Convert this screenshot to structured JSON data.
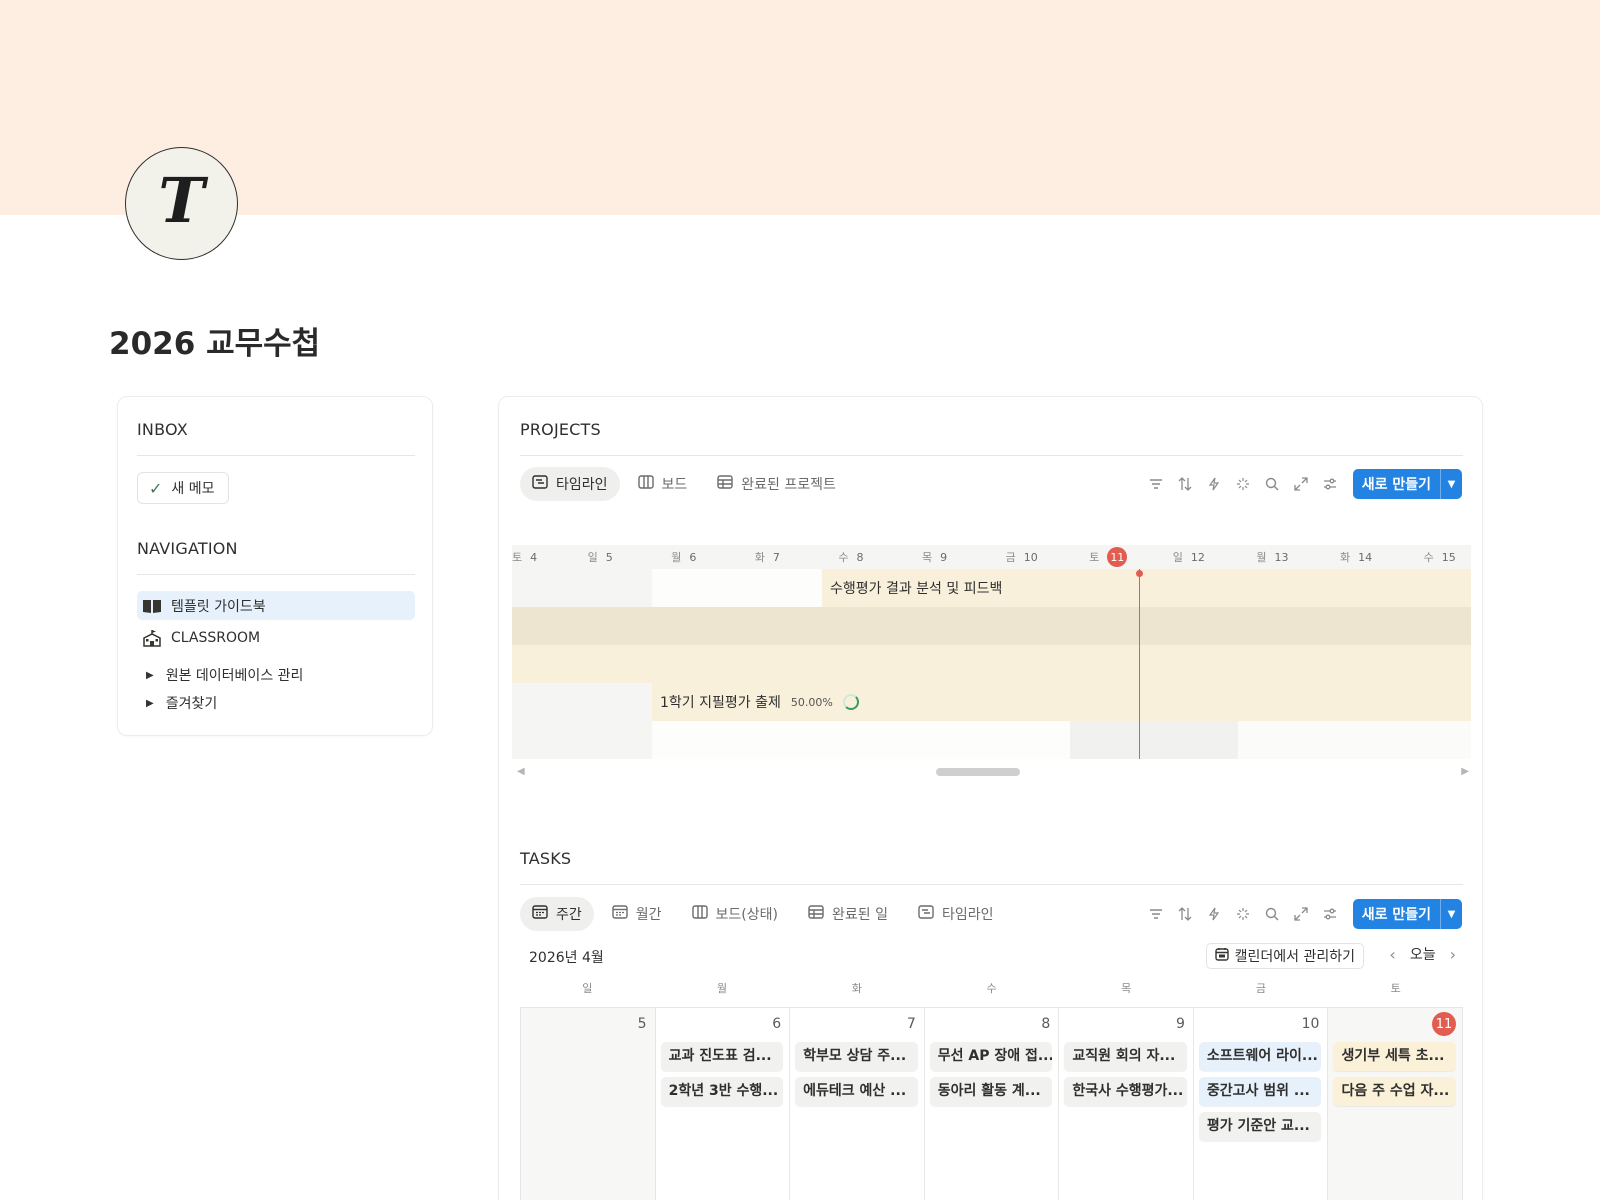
{
  "page": {
    "title": "2026 교무수첩",
    "logo_letter": "T",
    "cover_color": "#fdeee1"
  },
  "inbox": {
    "title": "INBOX",
    "memo_button": "새 메모"
  },
  "navigation": {
    "title": "NAVIGATION",
    "items": [
      {
        "label": "템플릿 가이드북",
        "icon": "book-icon",
        "active": true
      },
      {
        "label": "CLASSROOM",
        "icon": "school-icon",
        "active": false
      }
    ],
    "tree": [
      {
        "label": "원본 데이터베이스 관리"
      },
      {
        "label": "즐겨찾기"
      }
    ]
  },
  "projects": {
    "title": "PROJECTS",
    "tabs": [
      {
        "label": "타임라인",
        "icon": "timeline-icon",
        "active": true
      },
      {
        "label": "보드",
        "icon": "board-icon",
        "active": false
      },
      {
        "label": "완료된 프로젝트",
        "icon": "table-icon",
        "active": false
      }
    ],
    "new_button": "새로 만들기",
    "timeline": {
      "days": [
        {
          "dow": "토",
          "num": "4"
        },
        {
          "dow": "일",
          "num": "5"
        },
        {
          "dow": "월",
          "num": "6"
        },
        {
          "dow": "화",
          "num": "7"
        },
        {
          "dow": "수",
          "num": "8"
        },
        {
          "dow": "목",
          "num": "9"
        },
        {
          "dow": "금",
          "num": "10"
        },
        {
          "dow": "토",
          "num": "11",
          "today": true
        },
        {
          "dow": "일",
          "num": "12"
        },
        {
          "dow": "월",
          "num": "13"
        },
        {
          "dow": "화",
          "num": "14"
        },
        {
          "dow": "수",
          "num": "15"
        }
      ],
      "bars": [
        {
          "label": "수행평가 결과 분석 및 피드백",
          "progress": ""
        },
        {
          "label": "",
          "progress": ""
        },
        {
          "label": "",
          "progress": ""
        },
        {
          "label": "1학기 지필평가 출제",
          "progress": "50.00%"
        }
      ]
    }
  },
  "tasks": {
    "title": "TASKS",
    "tabs": [
      {
        "label": "주간",
        "icon": "calendar-icon",
        "active": true
      },
      {
        "label": "월간",
        "icon": "calendar-icon",
        "active": false
      },
      {
        "label": "보드(상태)",
        "icon": "board-icon",
        "active": false
      },
      {
        "label": "완료된 일",
        "icon": "table-icon",
        "active": false
      },
      {
        "label": "타임라인",
        "icon": "timeline-icon",
        "active": false
      }
    ],
    "new_button": "새로 만들기",
    "calendar": {
      "month_label": "2026년 4월",
      "manage_label": "캘린더에서 관리하기",
      "today_label": "오늘",
      "weekdays": [
        "일",
        "월",
        "화",
        "수",
        "목",
        "금",
        "토"
      ],
      "days": [
        {
          "date": "5",
          "events": []
        },
        {
          "date": "6",
          "events": [
            {
              "label": "교과 진도표 검...",
              "color": "gray"
            },
            {
              "label": "2학년 3반 수행...",
              "color": "gray"
            }
          ]
        },
        {
          "date": "7",
          "events": [
            {
              "label": "학부모 상담 주...",
              "color": "gray"
            },
            {
              "label": "에듀테크 예산 ...",
              "color": "gray"
            }
          ]
        },
        {
          "date": "8",
          "events": [
            {
              "label": "무선 AP 장애 접...",
              "color": "gray"
            },
            {
              "label": "동아리 활동 계...",
              "color": "gray"
            }
          ]
        },
        {
          "date": "9",
          "events": [
            {
              "label": "교직원 회의 자...",
              "color": "gray"
            },
            {
              "label": "한국사 수행평가...",
              "color": "gray"
            }
          ]
        },
        {
          "date": "10",
          "events": [
            {
              "label": "소프트웨어 라이...",
              "color": "blue"
            },
            {
              "label": "중간고사 범위 ...",
              "color": "blue"
            },
            {
              "label": "평가 기준안 교...",
              "color": "gray"
            }
          ]
        },
        {
          "date": "11",
          "today": true,
          "events": [
            {
              "label": "생기부 세특 초...",
              "color": "yellow"
            },
            {
              "label": "다음 주 수업 자...",
              "color": "yellow"
            }
          ]
        }
      ]
    }
  },
  "colors": {
    "accent": "#2383e2",
    "today": "#e25d4f",
    "timeline_bar": "#f8f0db",
    "timeline_bar_alt": "#ede5cf",
    "nav_active": "#e7f1fb"
  }
}
